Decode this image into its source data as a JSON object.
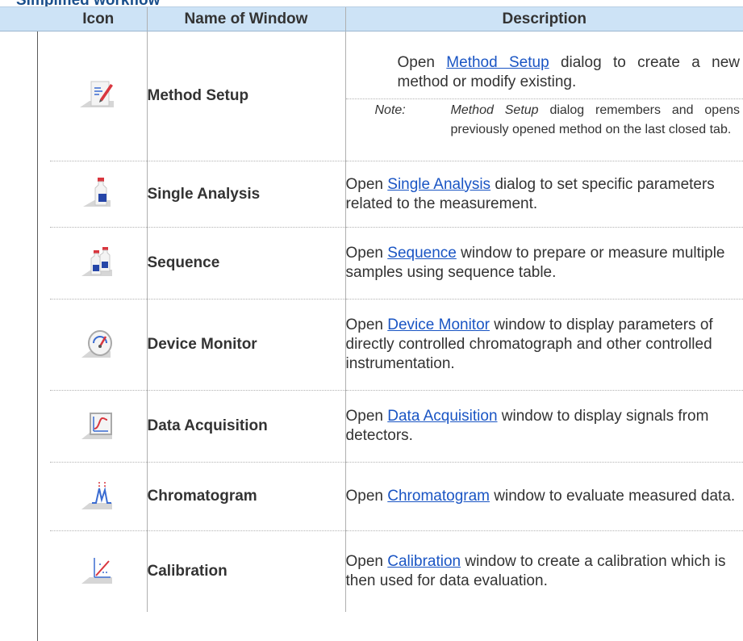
{
  "section_title": "Simplified workflow",
  "columns": {
    "icon": "Icon",
    "name": "Name of Window",
    "description": "Description"
  },
  "rows": [
    {
      "icon": "method-setup-icon",
      "name": "Method Setup",
      "desc_pre": "Open ",
      "desc_link": "Method Setup",
      "desc_post": " dialog to create a new method or modify existing.",
      "note_label": "Note:",
      "note_em": "Method Setup",
      "note_text": " dialog remembers and opens previously opened method on the last closed tab."
    },
    {
      "icon": "single-analysis-icon",
      "name": "Single Analysis",
      "desc_pre": "Open ",
      "desc_link": "Single Analysis",
      "desc_post": " dialog to set specific parameters related to the measurement."
    },
    {
      "icon": "sequence-icon",
      "name": "Sequence",
      "desc_pre": "Open ",
      "desc_link": "Sequence",
      "desc_post": " window to prepare or measure multiple samples using sequence table."
    },
    {
      "icon": "device-monitor-icon",
      "name": "Device Monitor",
      "desc_pre": "Open ",
      "desc_link": "Device Monitor",
      "desc_post": " window to display parameters of directly controlled chromatograph and other controlled instrumentation."
    },
    {
      "icon": "data-acquisition-icon",
      "name": "Data Acquisition",
      "desc_pre": "Open ",
      "desc_link": "Data Acquisition",
      "desc_post": " window to display signals from detectors."
    },
    {
      "icon": "chromatogram-icon",
      "name": "Chromatogram",
      "desc_pre": "Open ",
      "desc_link": "Chromatogram",
      "desc_post": " window to evaluate measured data."
    },
    {
      "icon": "calibration-icon",
      "name": "Calibration",
      "desc_pre": "Open ",
      "desc_link": "Calibration",
      "desc_post": " window to create a calibration which is then used for data evaluation."
    }
  ],
  "colors": {
    "header_bg": "#cde3f6",
    "link": "#1a55c4",
    "text": "#333333"
  }
}
